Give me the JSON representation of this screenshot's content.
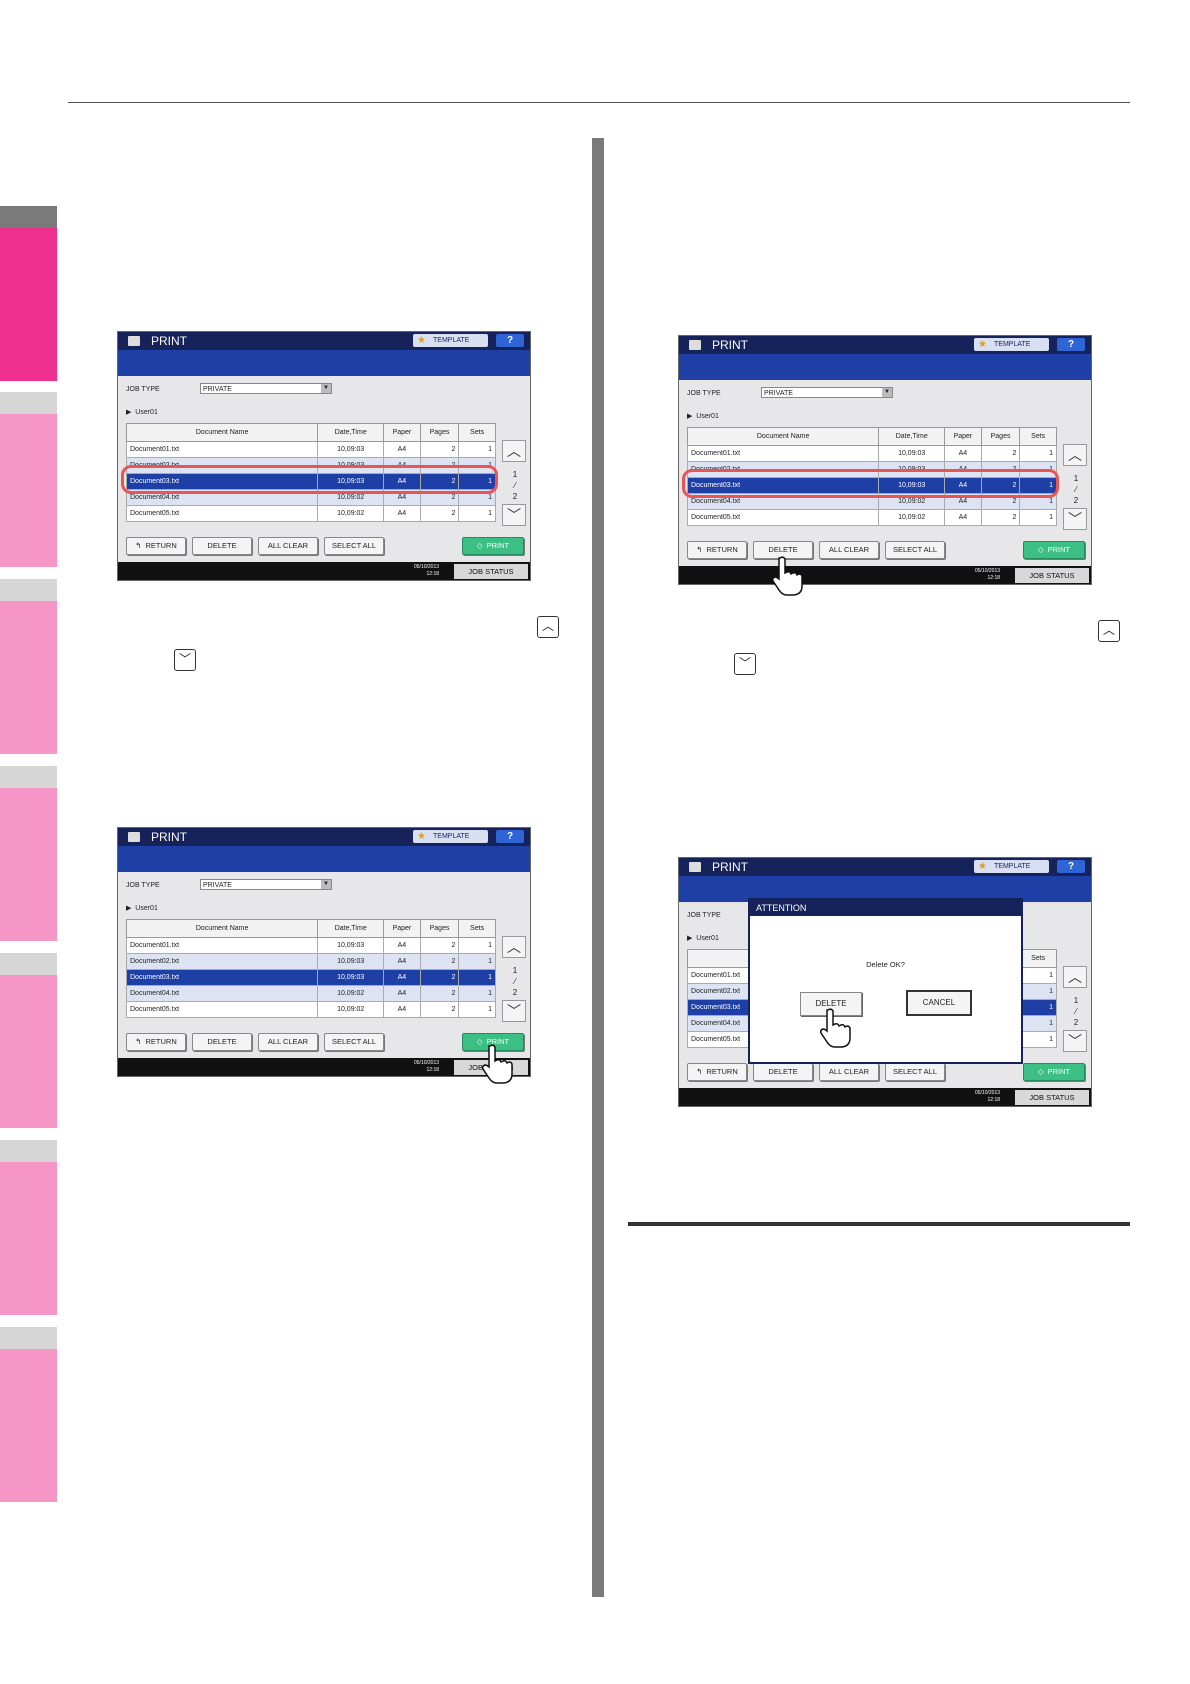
{
  "screens": [
    {
      "title": "PRINT",
      "template_label": "TEMPLATE",
      "help_label": "?",
      "job_type_label": "JOB TYPE",
      "job_type_value": "PRIVATE",
      "user_label": "User01",
      "columns": [
        "Document Name",
        "Date,Time",
        "Paper",
        "Pages",
        "Sets"
      ],
      "rows": [
        {
          "name": "Document01.txt",
          "date": "10,09:03",
          "paper": "A4",
          "pages": "2",
          "sets": "1"
        },
        {
          "name": "Document02.txt",
          "date": "10,09:03",
          "paper": "A4",
          "pages": "2",
          "sets": "1"
        },
        {
          "name": "Document03.txt",
          "date": "10,09:03",
          "paper": "A4",
          "pages": "2",
          "sets": "1"
        },
        {
          "name": "Document04.txt",
          "date": "10,09:02",
          "paper": "A4",
          "pages": "2",
          "sets": "1"
        },
        {
          "name": "Document05.txt",
          "date": "10,09:02",
          "paper": "A4",
          "pages": "2",
          "sets": "1"
        }
      ],
      "page_current": "1",
      "page_total": "2",
      "buttons": {
        "return": "RETURN",
        "delete": "DELETE",
        "all_clear": "ALL CLEAR",
        "select_all": "SELECT ALL",
        "print": "PRINT"
      },
      "clock": "05/10/2013\n12:18",
      "job_status": "JOB STATUS"
    }
  ],
  "dialog": {
    "title": "ATTENTION",
    "message": "Delete OK?",
    "delete": "DELETE",
    "cancel": "CANCEL"
  },
  "icons": [
    "printer-icon",
    "star-icon",
    "chevron-up-icon",
    "chevron-down-icon",
    "hand-pointer-icon"
  ],
  "colors": {
    "title_bar": "#16225a",
    "band": "#1e3fa6",
    "selected_row": "#1e3fa6",
    "alt_row": "#dde3f3",
    "print_button": "#3bbf84",
    "highlight": "#e85555",
    "tab_active": "#ee2f8e",
    "tab": "#f596c6"
  }
}
